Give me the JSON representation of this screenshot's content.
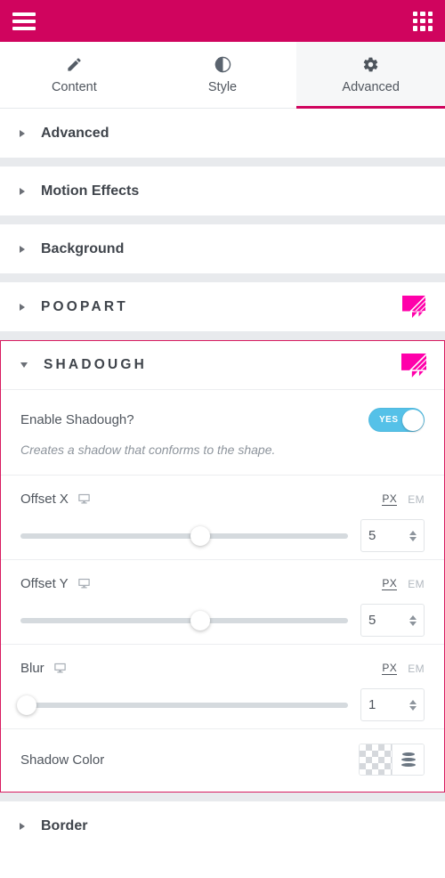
{
  "topbar": {
    "menu_icon": "hamburger-icon",
    "apps_icon": "grid-apps-icon",
    "bg_color": "#d0045e"
  },
  "tabs": [
    {
      "label": "Content",
      "icon": "pencil-icon",
      "active": false
    },
    {
      "label": "Style",
      "icon": "contrast-icon",
      "active": false
    },
    {
      "label": "Advanced",
      "icon": "gear-icon",
      "active": true
    }
  ],
  "sections": [
    {
      "title": "Advanced",
      "open": false,
      "logo": false
    },
    {
      "title": "Motion Effects",
      "open": false,
      "logo": false
    },
    {
      "title": "Background",
      "open": false,
      "logo": false
    },
    {
      "title": "POOPART",
      "open": false,
      "logo": true
    }
  ],
  "open_section": {
    "title": "SHADOUGH",
    "logo": true,
    "accent_color": "#d81b60",
    "enable": {
      "label": "Enable Shadough?",
      "toggle_value": "YES",
      "toggle_on": true,
      "toggle_color": "#55c1e8",
      "description": "Creates a shadow that conforms to the shape."
    },
    "controls": [
      {
        "label": "Offset X",
        "device_icon": "monitor-icon",
        "units": [
          "PX",
          "EM"
        ],
        "active_unit": "PX",
        "value": "5",
        "slider_percent": 55
      },
      {
        "label": "Offset Y",
        "device_icon": "monitor-icon",
        "units": [
          "PX",
          "EM"
        ],
        "active_unit": "PX",
        "value": "5",
        "slider_percent": 55
      },
      {
        "label": "Blur",
        "device_icon": "monitor-icon",
        "units": [
          "PX",
          "EM"
        ],
        "active_unit": "PX",
        "value": "1",
        "slider_percent": 2
      }
    ],
    "shadow_color": {
      "label": "Shadow Color",
      "swatch": "transparent-checkered",
      "globals_icon": "color-stack-icon"
    }
  },
  "bottom_sections": [
    {
      "title": "Border",
      "open": false,
      "logo": false
    }
  ]
}
